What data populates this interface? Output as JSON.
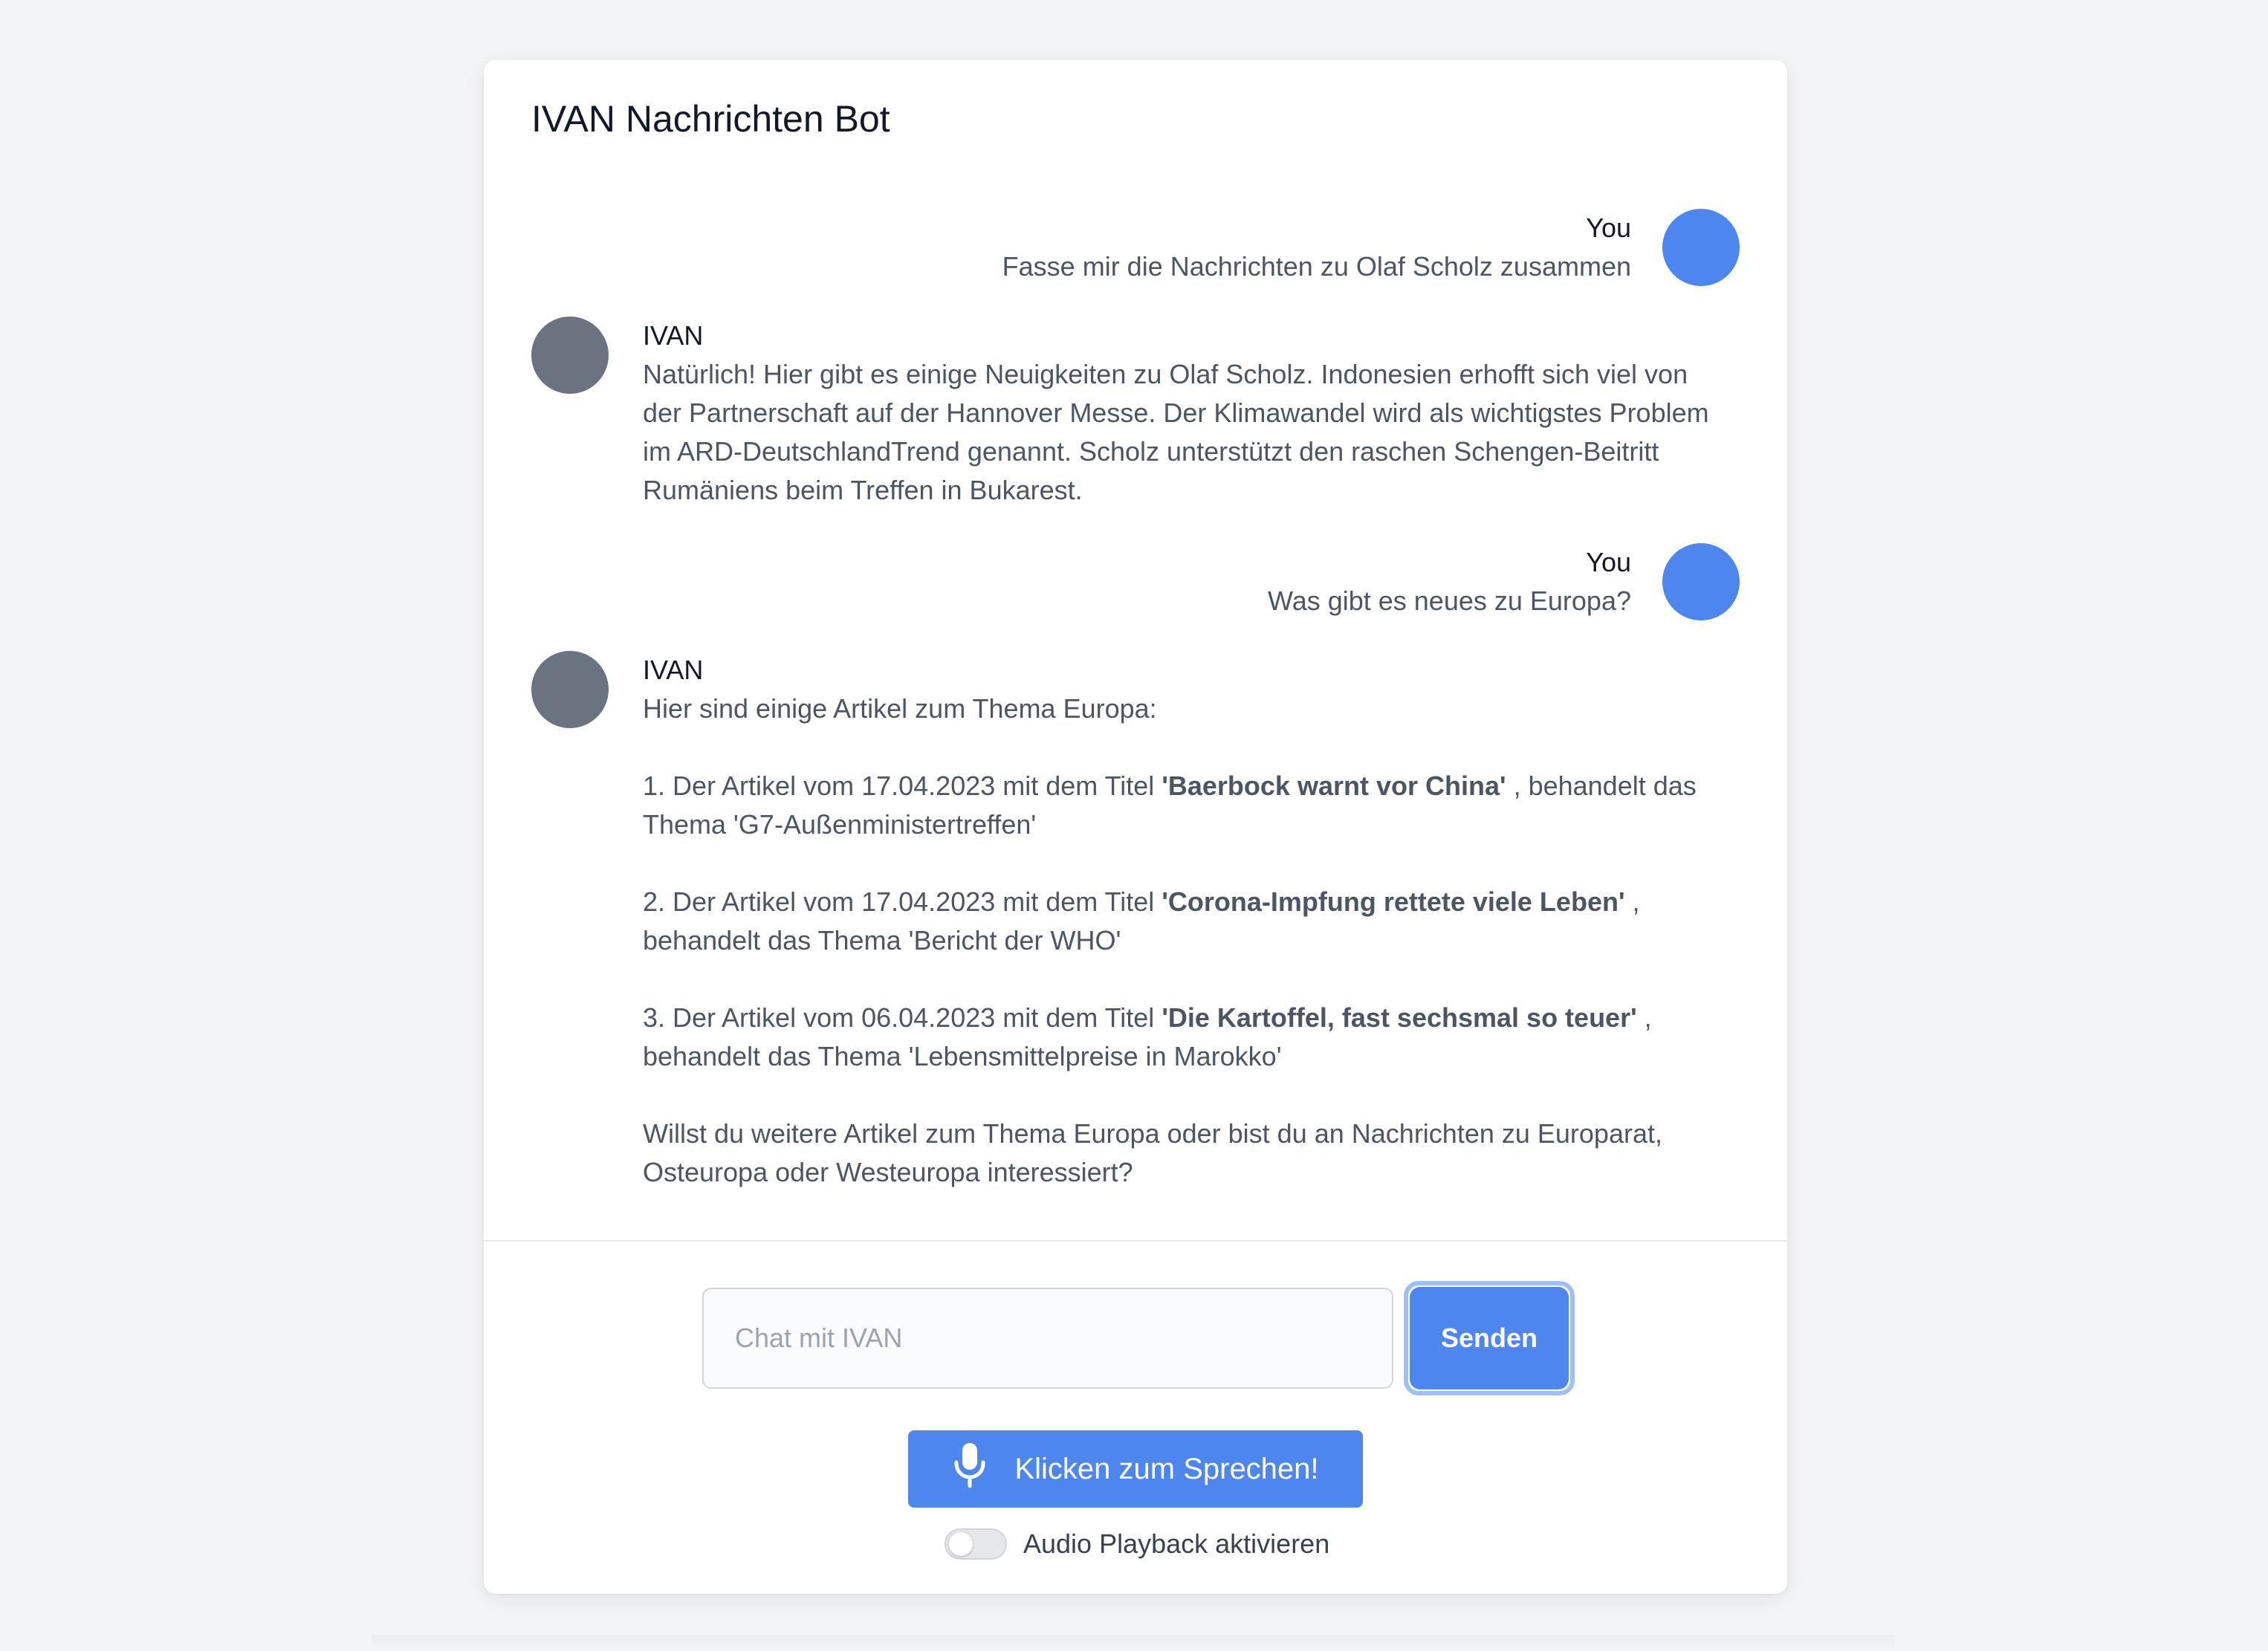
{
  "header": {
    "title": "IVAN Nachrichten Bot"
  },
  "messages": [
    {
      "sender": "You",
      "text": "Fasse mir die Nachrichten zu Olaf Scholz zusammen"
    },
    {
      "sender": "IVAN",
      "text": "Natürlich! Hier gibt es einige Neuigkeiten zu Olaf Scholz. Indonesien erhofft sich viel von der Partnerschaft auf der Hannover Messe. Der Klimawandel wird als wichtigstes Problem im ARD-DeutschlandTrend genannt. Scholz unterstützt den raschen Schengen-Beitritt Rumäniens beim Treffen in Bukarest."
    },
    {
      "sender": "You",
      "text": "Was gibt es neues zu Europa?"
    },
    {
      "sender": "IVAN",
      "intro": "Hier sind einige Artikel zum Thema Europa:",
      "articles": [
        {
          "prefix": "1. Der Artikel vom 17.04.2023 mit dem Titel ",
          "title": "'Baerbock warnt vor China'",
          "suffix": " , behandelt das Thema 'G7-Außenministertreffen'"
        },
        {
          "prefix": "2. Der Artikel vom 17.04.2023 mit dem Titel ",
          "title": "'Corona-Impfung rettete viele Leben'",
          "suffix": " , behandelt das Thema 'Bericht der WHO'"
        },
        {
          "prefix": "3. Der Artikel vom 06.04.2023 mit dem Titel ",
          "title": "'Die Kartoffel, fast sechsmal so teuer'",
          "suffix": " , behandelt das Thema 'Lebensmittelpreise in Marokko'"
        }
      ],
      "outro": "Willst du weitere Artikel zum Thema Europa oder bist du an Nachrichten zu Europarat, Osteuropa oder Westeuropa interessiert?"
    }
  ],
  "composer": {
    "placeholder": "Chat mit IVAN",
    "send_label": "Senden",
    "speak_label": "Klicken zum Sprechen!",
    "speak_icon": "microphone-icon",
    "audio_toggle_label": "Audio Playback aktivieren",
    "audio_toggle_on": false
  },
  "colors": {
    "accent": "#4d86ee",
    "user_avatar": "#4d86ee",
    "bot_avatar": "#6b7280",
    "background": "#f3f4f6"
  }
}
